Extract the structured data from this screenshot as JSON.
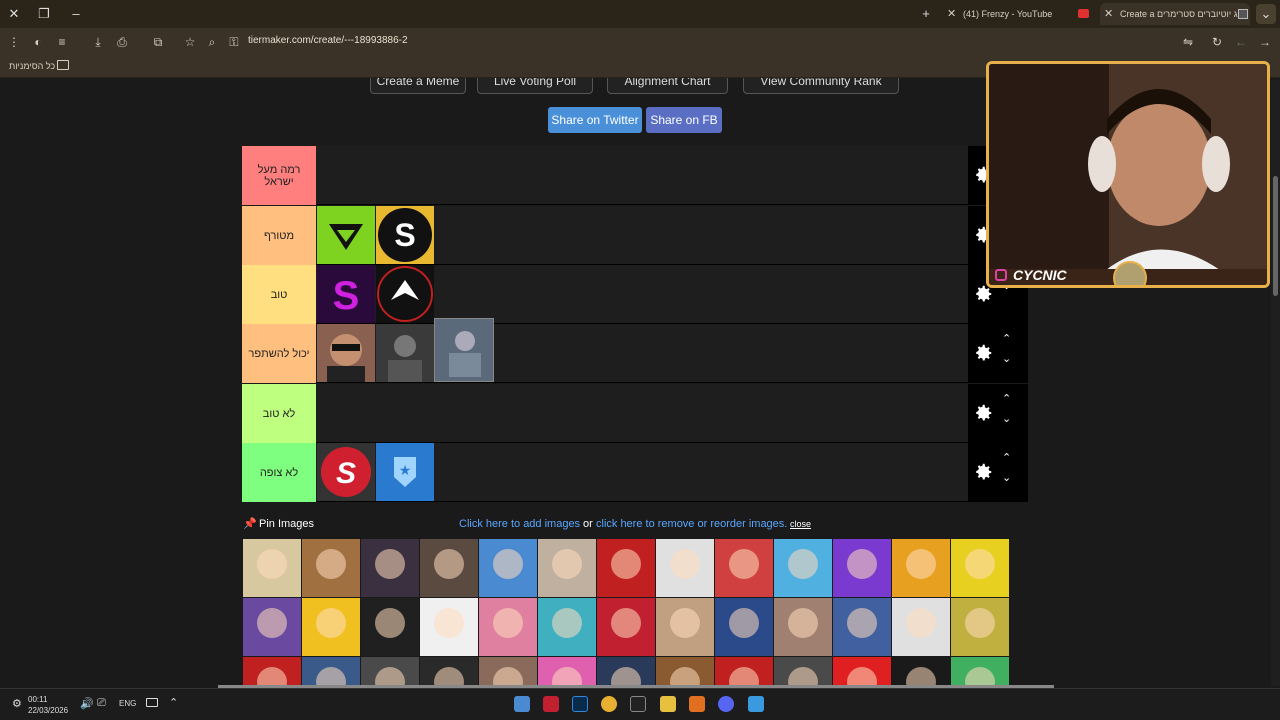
{
  "browser": {
    "tabs": [
      {
        "label": "Create a זוג יוטיוברים סטרימרים",
        "active": true
      },
      {
        "label": "(41) Frenzy - YouTube",
        "active": false
      }
    ],
    "url": "tiermaker.com/create/---18993886-2",
    "bookmarks_all_label": "כל הסימניות"
  },
  "page": {
    "top_buttons": [
      "Create a Meme",
      "Live Voting Poll",
      "Alignment Chart",
      "View Community Rank"
    ],
    "share_twitter": "Share on Twitter",
    "share_fb": "Share on FB",
    "tiers": [
      {
        "label": "רמה מעל ישראל",
        "color": "#ff7f7f",
        "items": 0
      },
      {
        "label": "מטורף",
        "color": "#ffbf7f",
        "items": 2
      },
      {
        "label": "טוב",
        "color": "#ffdf7f",
        "items": 2
      },
      {
        "label": "יכול להשתפר",
        "color": "#ffbf7f",
        "items": 3
      },
      {
        "label": "לא טוב",
        "color": "#bfff7f",
        "items": 0
      },
      {
        "label": "לא צופה",
        "color": "#7fff7f",
        "items": 2
      }
    ],
    "pin_images_label": "Pin Images",
    "add_images_link": "Click here to add images",
    "or_text": "or",
    "reorder_link": "click here to remove or reorder images.",
    "close_link": "close"
  },
  "webcam": {
    "name": "CYCNIC"
  },
  "taskbar": {
    "time": "00:11",
    "date": "22/03/2026",
    "lang": "ENG"
  },
  "colors": {
    "share_twitter": "#4a90d9",
    "share_fb": "#5a6fc4",
    "link": "#5aa7ff",
    "webcam_border": "#e8b04a"
  }
}
